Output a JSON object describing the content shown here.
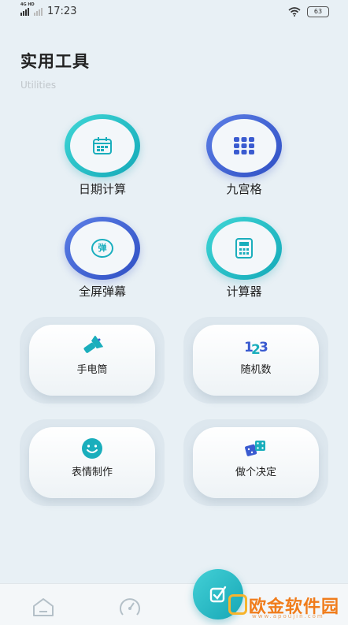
{
  "status_bar": {
    "network": "4G HD",
    "time": "17:23",
    "battery": "63"
  },
  "header": {
    "title": "实用工具",
    "subtitle": "Utilities"
  },
  "round_tools": [
    {
      "label": "日期计算",
      "icon": "calendar-icon",
      "color": "#1aaebc"
    },
    {
      "label": "九宫格",
      "icon": "grid-icon",
      "color": "#3a5bd0"
    },
    {
      "label": "全屏弹幕",
      "icon": "barrage-icon",
      "badge": "弹",
      "color": "#3a5bd0"
    },
    {
      "label": "计算器",
      "icon": "calculator-icon",
      "color": "#1aaebc"
    }
  ],
  "card_tools": [
    {
      "label": "手电筒",
      "icon": "flashlight-icon"
    },
    {
      "label": "随机数",
      "icon": "random-number-icon",
      "glyph": "123"
    },
    {
      "label": "表情制作",
      "icon": "smiley-icon"
    },
    {
      "label": "做个决定",
      "icon": "dice-icon"
    }
  ],
  "tab_bar": {
    "items": [
      "home-icon",
      "dial-icon",
      "tools-icon"
    ]
  },
  "watermark": {
    "text": "欧金软件园",
    "url": "www.apoujin.com"
  },
  "colors": {
    "accent_cyan": "#1aaebc",
    "accent_blue": "#3a5bd0",
    "background": "#e8f0f5"
  }
}
